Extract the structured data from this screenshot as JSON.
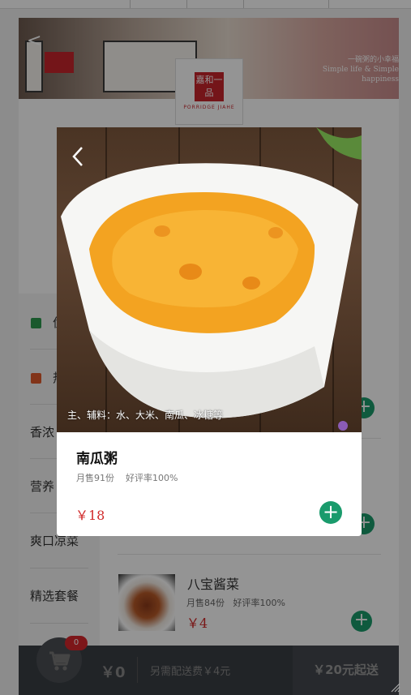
{
  "store": {
    "logo_text": "嘉和一品",
    "logo_sub": "PORRIDGE JIAHE",
    "hero_slogan_1": "一碗粥的小幸福",
    "hero_slogan_2": "Simple life & Simple happiness"
  },
  "sidebar": {
    "items": [
      {
        "label": "优"
      },
      {
        "label": "热"
      },
      {
        "label": "香浓"
      },
      {
        "label": "营养"
      },
      {
        "label": "爽口凉菜"
      },
      {
        "label": "精选套餐"
      }
    ]
  },
  "list": {
    "item": {
      "name": "八宝酱菜",
      "sales": "月售84份",
      "rating": "好评率100%",
      "price": "￥4"
    }
  },
  "footer": {
    "badge": "0",
    "total": "￥0",
    "fee": "另需配送费￥4元",
    "checkout": "￥20元起送"
  },
  "popup": {
    "ingredients": "主、辅料：水、大米、南瓜、冰糖等",
    "name": "南瓜粥",
    "sales": "月售91份",
    "rating": "好评率100%",
    "price": "￥18"
  },
  "colors": {
    "accent_green": "#1a9b6c",
    "price_red": "#d02828",
    "brand_red": "#c9252c",
    "footer_bg": "#3a3e44"
  }
}
